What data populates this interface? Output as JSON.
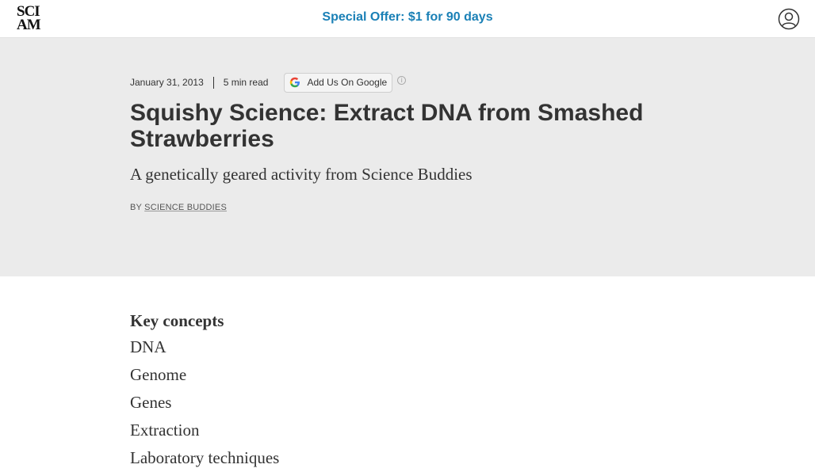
{
  "header": {
    "logo_line1": "SCI",
    "logo_line2": "AM",
    "offer_text": "Special Offer: $1 for 90 days",
    "account_icon": "user-circle-icon",
    "accent_color": "#1a80b6"
  },
  "article": {
    "date": "January 31, 2013",
    "read_time": "5 min read",
    "google_button_label": "Add Us On Google",
    "info_icon": "info-icon",
    "title": "Squishy Science: Extract DNA from Smashed Strawberries",
    "subtitle": "A genetically geared activity from Science Buddies",
    "byline_prefix": "BY",
    "author": "SCIENCE BUDDIES"
  },
  "key_concepts": {
    "heading": "Key concepts",
    "items": [
      "DNA",
      "Genome",
      "Genes",
      "Extraction",
      "Laboratory techniques"
    ]
  }
}
